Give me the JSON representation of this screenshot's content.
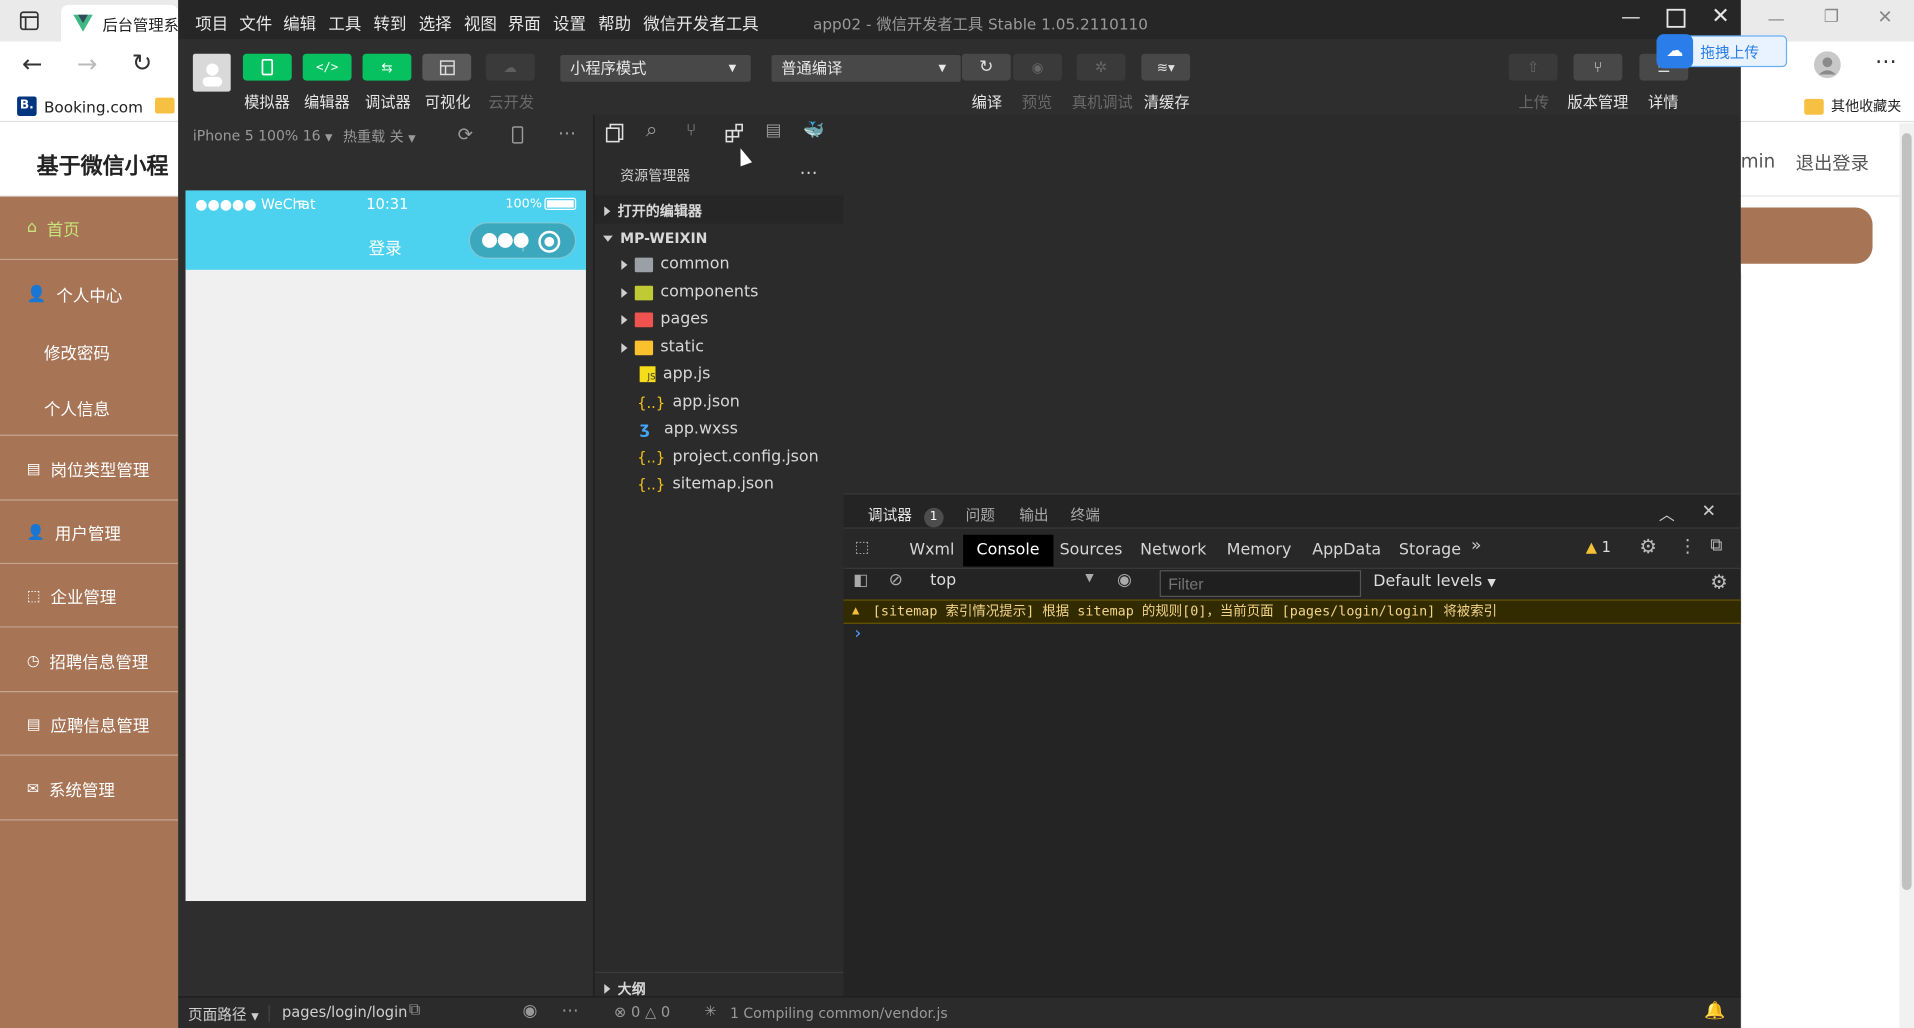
{
  "browser": {
    "tab_title": "后台管理系",
    "bookmark_booking": "Booking.com",
    "bookmark_other": "其他收藏夹"
  },
  "admin": {
    "title": "基于微信小程",
    "user_partial": "min",
    "logout": "退出登录",
    "sidebar": {
      "home": "首页",
      "personal_center": "个人中心",
      "change_password": "修改密码",
      "personal_info": "个人信息",
      "job_type": "岗位类型管理",
      "user_mgmt": "用户管理",
      "company_mgmt": "企业管理",
      "recruit_mgmt": "招聘信息管理",
      "apply_mgmt": "应聘信息管理",
      "system_mgmt": "系统管理"
    },
    "sidebar_color": "#a77456"
  },
  "ide": {
    "window_title": "app02 - 微信开发者工具 Stable 1.05.2110110",
    "menu": [
      "项目",
      "文件",
      "编辑",
      "工具",
      "转到",
      "选择",
      "视图",
      "界面",
      "设置",
      "帮助",
      "微信开发者工具"
    ],
    "toolbar": {
      "simulator": "模拟器",
      "editor": "编辑器",
      "debugger": "调试器",
      "visual": "可视化",
      "cloud": "云开发",
      "mode_select": "小程序模式",
      "compile_select": "普通编译",
      "compile": "编译",
      "preview": "预览",
      "remote_debug": "真机调试",
      "clear_cache": "清缓存",
      "upload": "上传",
      "version_mgmt": "版本管理",
      "details": "详情",
      "drag_upload": "拖拽上传"
    },
    "sim": {
      "device": "iPhone 5 100% 16",
      "hot_reload": "热重载 关",
      "carrier": "●●●●● WeChat",
      "time": "10:31",
      "battery": "100%",
      "page_title": "登录"
    },
    "explorer": {
      "title": "资源管理器",
      "open_editors": "打开的编辑器",
      "project": "MP-WEIXIN",
      "folders": [
        "common",
        "components",
        "pages",
        "static"
      ],
      "files": [
        "app.js",
        "app.json",
        "app.wxss",
        "project.config.json",
        "sitemap.json"
      ],
      "outline": "大纲"
    },
    "debugger": {
      "tabs": [
        "调试器",
        "问题",
        "输出",
        "终端"
      ],
      "badge": "1",
      "devtools_tabs": [
        "Wxml",
        "Console",
        "Sources",
        "Network",
        "Memory",
        "AppData",
        "Storage"
      ],
      "active_tab": "Console",
      "warn_count": "1",
      "context": "top",
      "filter_placeholder": "Filter",
      "levels": "Default levels",
      "warning_message": "[sitemap 索引情况提示] 根据 sitemap 的规则[0]，当前页面 [pages/login/login] 将被索引",
      "prompt": "›"
    },
    "status": {
      "page_path_label": "页面路径",
      "page_path": "pages/login/login",
      "errors": "0",
      "warnings": "0",
      "compiling": "1 Compiling common/vendor.js"
    },
    "accent_green": "#07c160"
  }
}
